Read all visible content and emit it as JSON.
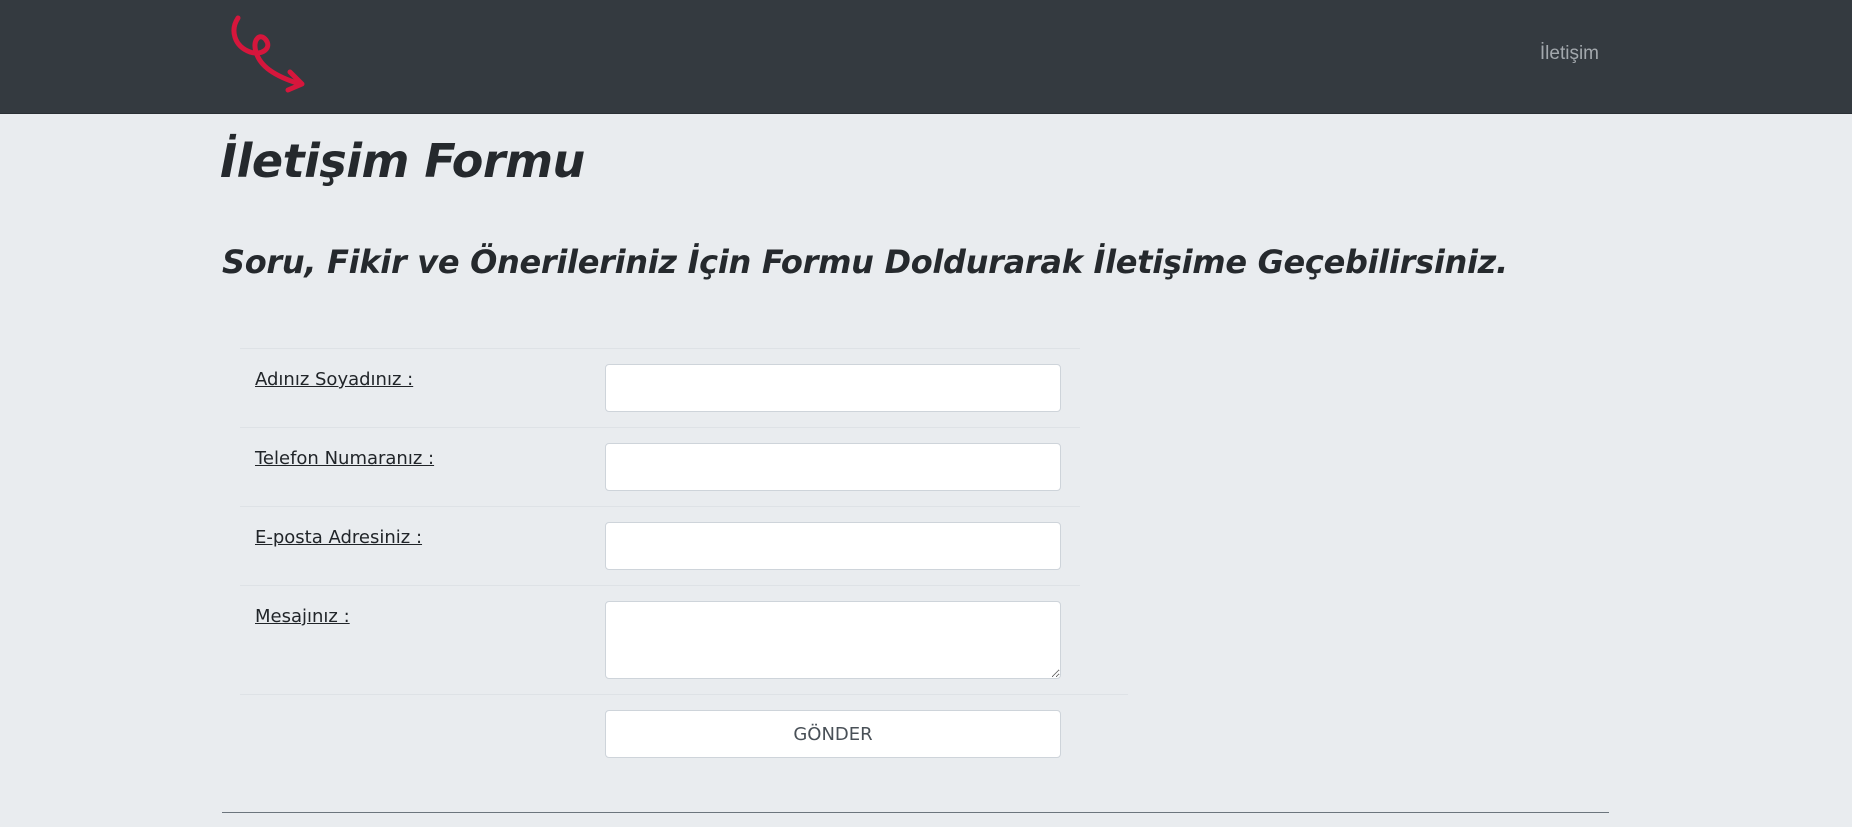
{
  "navbar": {
    "logo_color": "#d6163c",
    "background": "#343a40",
    "links": [
      {
        "label": "İletişim"
      }
    ]
  },
  "page": {
    "title": "İletişim Formu",
    "subtitle": "Soru, Fikir ve Önerileriniz İçin Formu Doldurarak İletişime Geçebilirsiniz."
  },
  "form": {
    "fields": [
      {
        "label": "Adınız Soyadınız :",
        "value": "",
        "placeholder": ""
      },
      {
        "label": "Telefon Numaranız :",
        "value": "",
        "placeholder": ""
      },
      {
        "label": "E-posta Adresiniz :",
        "value": "",
        "placeholder": ""
      },
      {
        "label": "Mesajınız :",
        "value": "",
        "placeholder": ""
      }
    ],
    "submit_label": "GÖNDER"
  }
}
